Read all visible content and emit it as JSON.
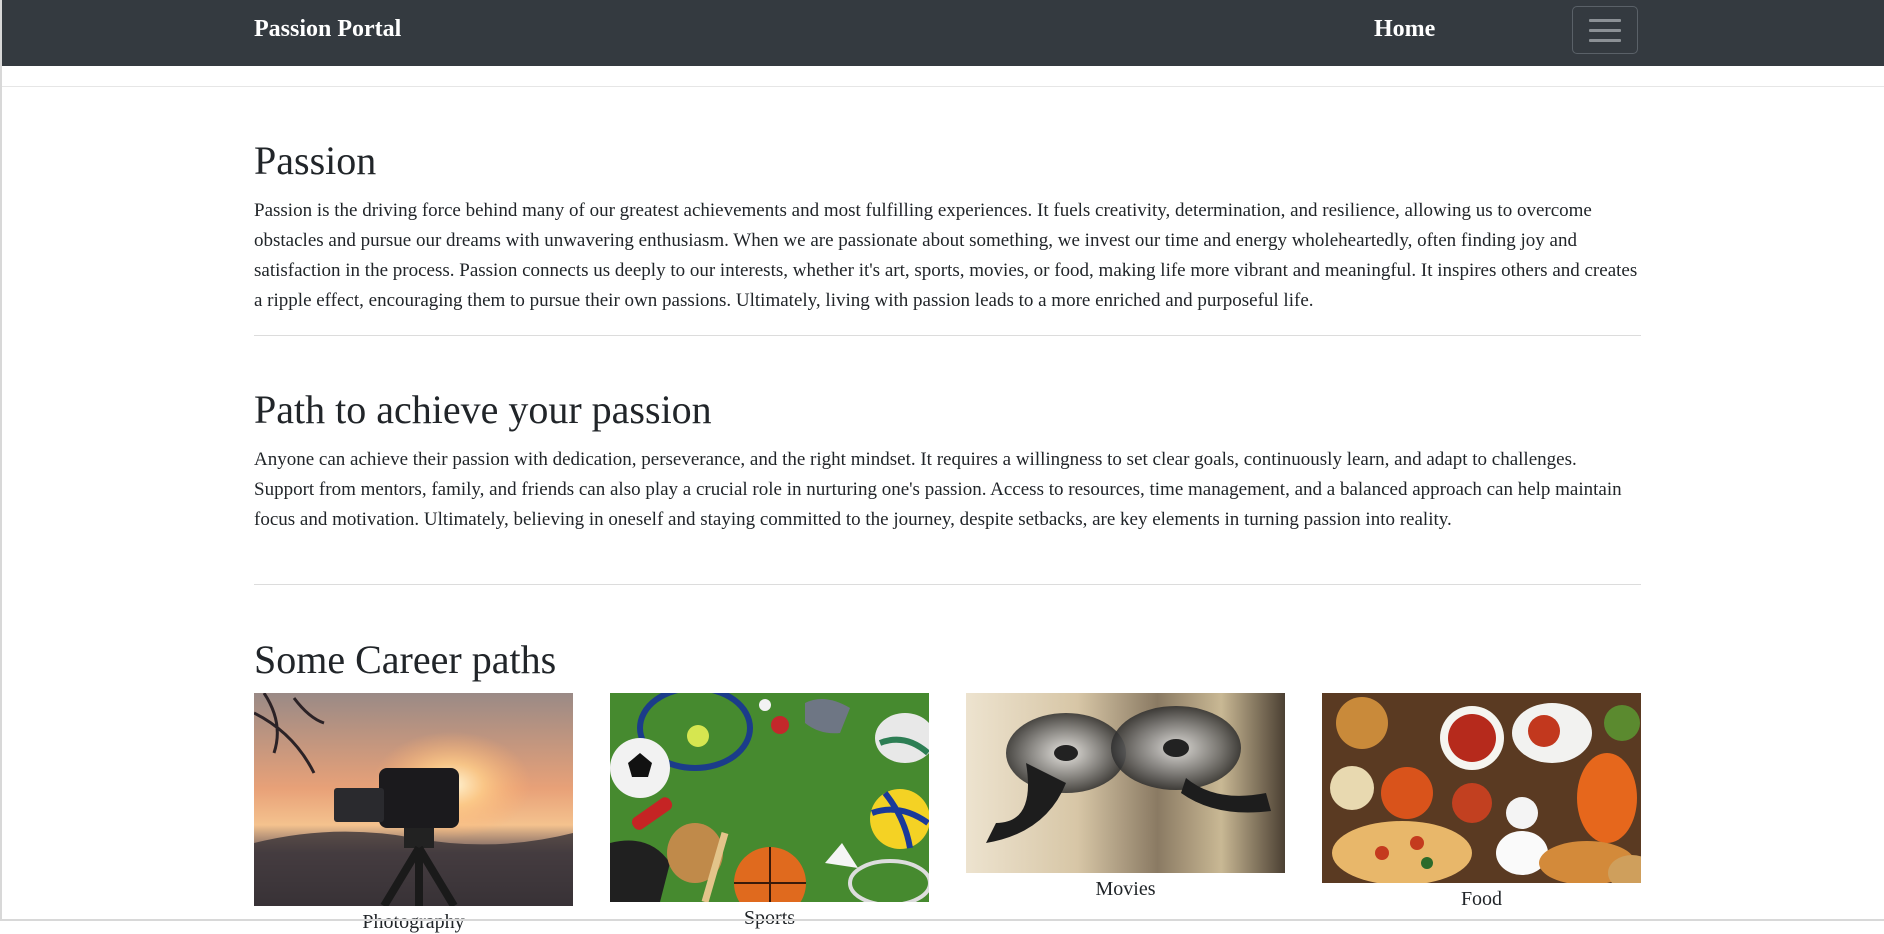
{
  "navbar": {
    "brand": "Passion Portal",
    "home_label": "Home",
    "menu_icon": "hamburger-menu-icon"
  },
  "sections": [
    {
      "title": "Passion",
      "body": "Passion is the driving force behind many of our greatest achievements and most fulfilling experiences. It fuels creativity, determination, and resilience, allowing us to overcome obstacles and pursue our dreams with unwavering enthusiasm. When we are passionate about something, we invest our time and energy wholeheartedly, often finding joy and satisfaction in the process. Passion connects us deeply to our interests, whether it's art, sports, movies, or food, making life more vibrant and meaningful. It inspires others and creates a ripple effect, encouraging them to pursue their own passions. Ultimately, living with passion leads to a more enriched and purposeful life."
    },
    {
      "title": "Path to achieve your passion",
      "body": "Anyone can achieve their passion with dedication, perseverance, and the right mindset. It requires a willingness to set clear goals, continuously learn, and adapt to challenges. Support from mentors, family, and friends can also play a crucial role in nurturing one's passion. Access to resources, time management, and a balanced approach can help maintain focus and motivation. Ultimately, believing in oneself and staying committed to the journey, despite setbacks, are key elements in turning passion into reality."
    }
  ],
  "careers": {
    "title": "Some Career paths",
    "cards": [
      {
        "caption": "Photography",
        "image": "camera-sunset-image"
      },
      {
        "caption": "Sports",
        "image": "sports-equipment-image"
      },
      {
        "caption": "Movies",
        "image": "film-reels-image"
      },
      {
        "caption": "Food",
        "image": "food-platter-image"
      }
    ]
  },
  "colors": {
    "navbar_bg": "#343a40",
    "text": "#212529"
  }
}
